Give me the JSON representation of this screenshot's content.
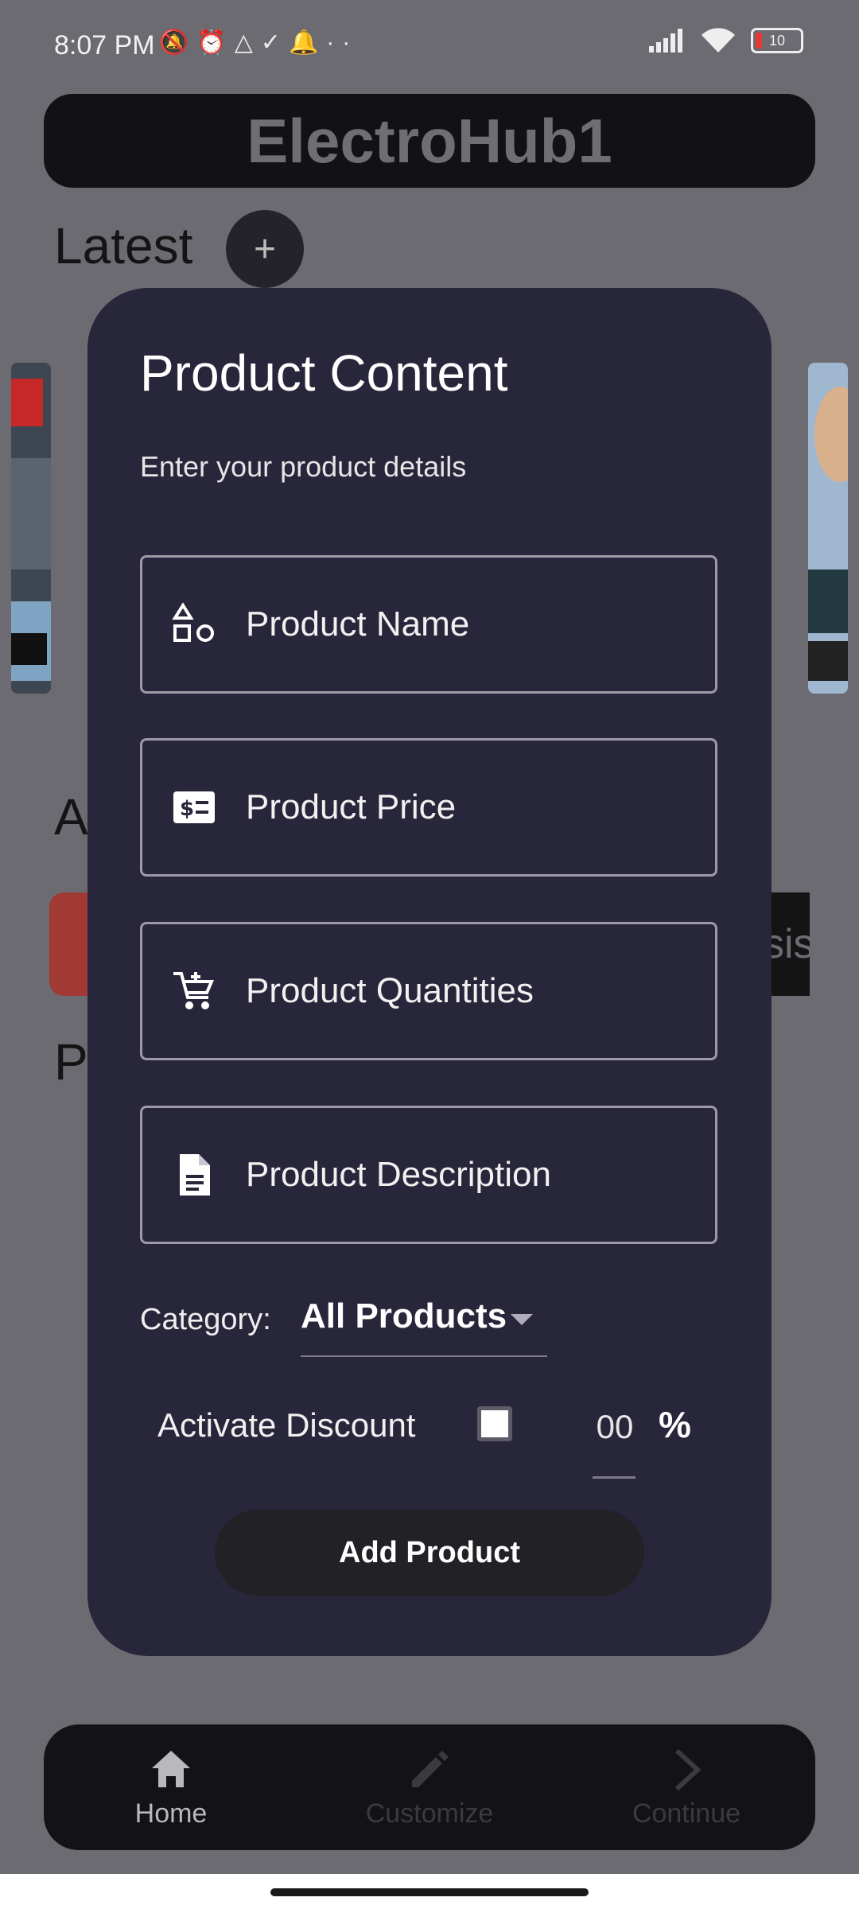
{
  "status_bar": {
    "time": "8:07 PM",
    "left_icons": [
      "muted-bell-icon",
      "alarm-icon",
      "drive-icon",
      "check-icon",
      "bell-icon",
      "more-dots-icon"
    ],
    "battery": "10"
  },
  "app": {
    "title": "ElectroHub1"
  },
  "background": {
    "latest_label": "Latest",
    "add_icon": "+",
    "letter_a": "A",
    "letter_p": "P",
    "clipped_text": "sis"
  },
  "modal": {
    "title": "Product Content",
    "subtitle": "Enter your product details",
    "fields": [
      {
        "placeholder": "Product Name",
        "icon": "shapes-icon"
      },
      {
        "placeholder": "Product Price",
        "icon": "price-tag-icon"
      },
      {
        "placeholder": "Product Quantities",
        "icon": "cart-icon"
      },
      {
        "placeholder": "Product Description",
        "icon": "document-icon"
      }
    ],
    "category_label": "Category:",
    "category_value": "All Products",
    "discount_label": "Activate Discount",
    "discount_value": "00",
    "percent_sign": "%",
    "add_button": "Add Product"
  },
  "bottom_nav": {
    "items": [
      {
        "label": "Home",
        "icon": "home-icon",
        "active": true
      },
      {
        "label": "Customize",
        "icon": "pencil-icon",
        "active": false
      },
      {
        "label": "Continue",
        "icon": "chevron-right-icon",
        "active": false
      }
    ]
  },
  "colors": {
    "modal_bg": "#28263a",
    "page_bg": "#6d6b72",
    "active_nav": "#b9b9bd",
    "inactive_nav": "#3a3a40"
  }
}
